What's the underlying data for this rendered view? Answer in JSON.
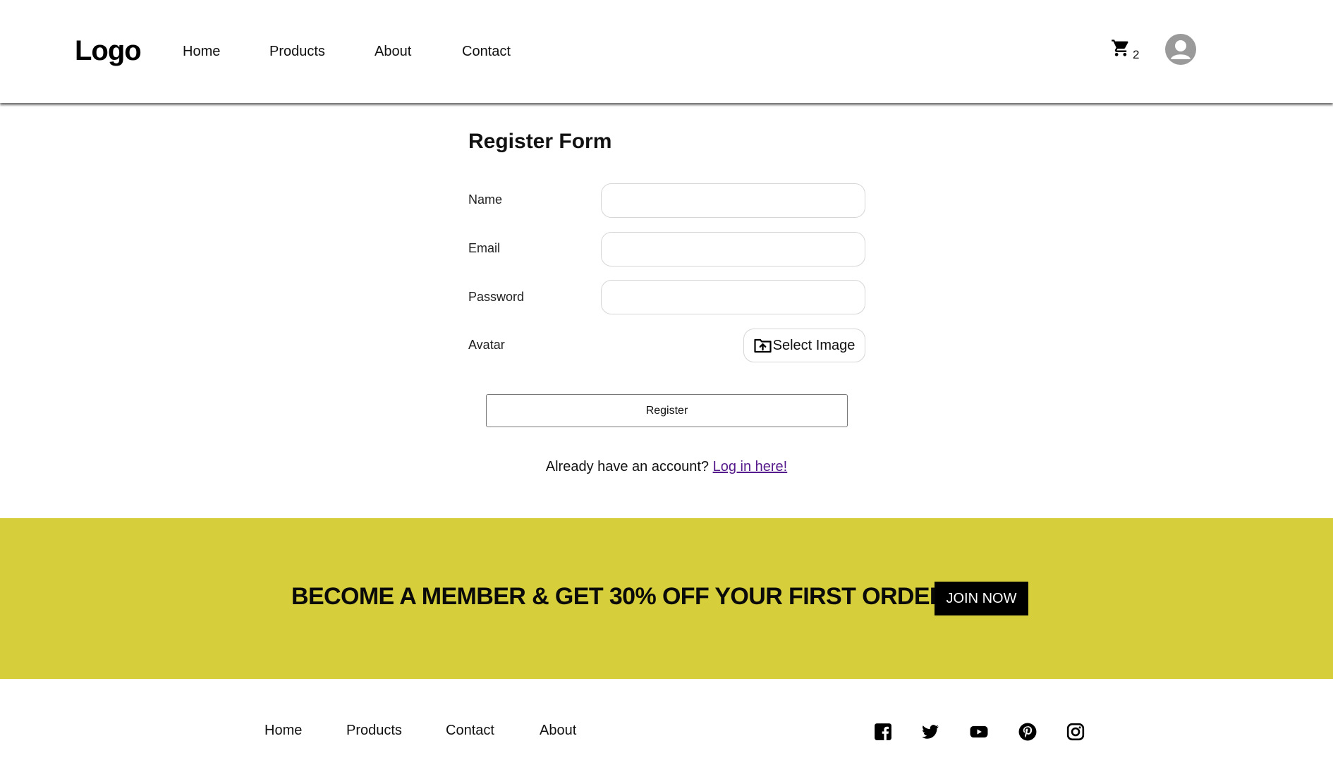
{
  "header": {
    "logo": "Logo",
    "nav": [
      "Home",
      "Products",
      "About",
      "Contact"
    ],
    "cart_count": "2"
  },
  "form": {
    "title": "Register Form",
    "name_label": "Name",
    "name_value": "",
    "email_label": "Email",
    "email_value": "",
    "password_label": "Password",
    "password_value": "",
    "avatar_label": "Avatar",
    "select_image_label": "Select Image",
    "register_label": "Register",
    "login_prompt": "Already have an account?",
    "login_link": "Log in here!"
  },
  "banner": {
    "text": "BECOME A MEMBER & GET 30% OFF YOUR FIRST ORDER",
    "button": "JOIN NOW",
    "background_color": "#d6ce3a"
  },
  "footer": {
    "links": [
      "Home",
      "Products",
      "Contact",
      "About"
    ],
    "social_icons": [
      "facebook-icon",
      "twitter-icon",
      "youtube-icon",
      "pinterest-icon",
      "instagram-icon"
    ]
  }
}
